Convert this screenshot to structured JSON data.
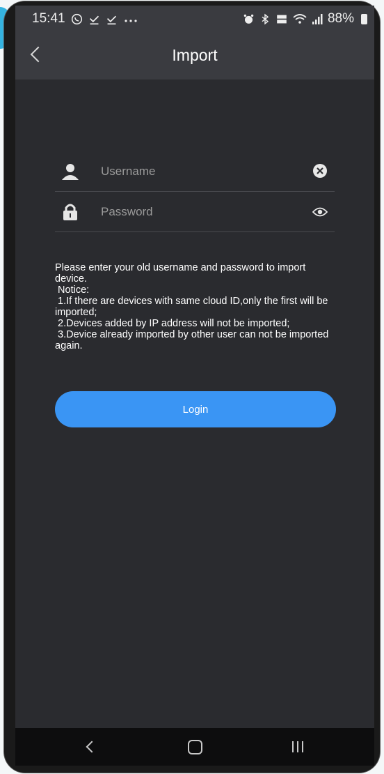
{
  "status_bar": {
    "time": "15:41",
    "left_icons": [
      "whatsapp-icon",
      "download-done-icon",
      "download-done-icon",
      "more-dots-icon"
    ],
    "right_icons": [
      "alarm-icon",
      "bluetooth-icon",
      "volte-icon",
      "wifi-icon",
      "signal-icon"
    ],
    "battery": "88%"
  },
  "app_bar": {
    "title": "Import"
  },
  "form": {
    "username_placeholder": "Username",
    "password_placeholder": "Password"
  },
  "notice": {
    "text": "Please enter your old username and password to import device.\n Notice:\n 1.If there are devices with same cloud ID,only the first will be imported;\n 2.Devices added by IP address will not be imported;\n 3.Device already imported by other user can not be imported again."
  },
  "login": {
    "label": "Login"
  },
  "colors": {
    "screen_bg": "#2a2b2f",
    "bar_bg": "#3a3b40",
    "accent": "#3a95f4",
    "nav_bg": "#0d0d0e"
  }
}
